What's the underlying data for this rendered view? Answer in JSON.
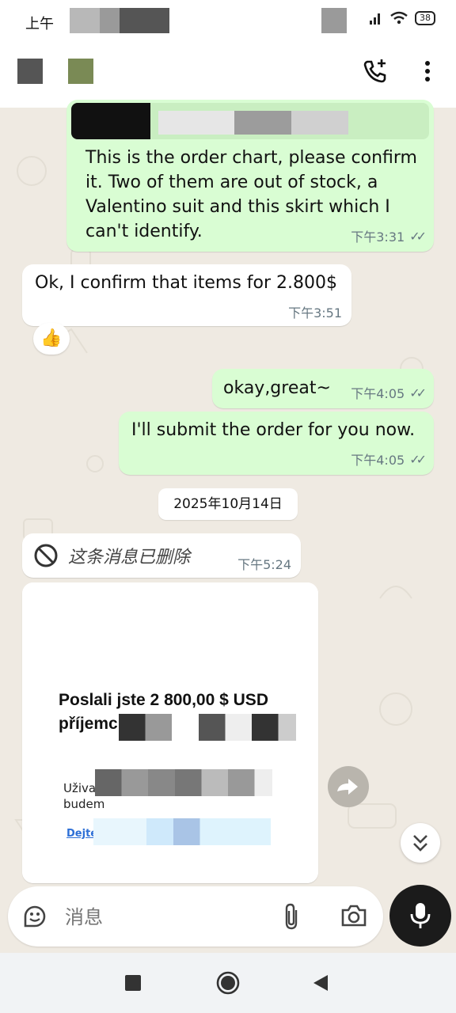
{
  "status_bar": {
    "time": "上午",
    "battery": "38"
  },
  "messages": [
    {
      "text": "This is the order chart, please confirm it. Two of them are out of stock, a Valentino suit and this skirt which I can't identify.",
      "time": "下午3:31"
    },
    {
      "text": "Ok, I confirm that items for 2.800$",
      "time": "下午3:51",
      "reaction": "👍"
    },
    {
      "text": "okay,great~",
      "time": "下午4:05"
    },
    {
      "text": "I'll submit the order for you now.",
      "time": "下午4:05"
    }
  ],
  "date_divider": "2025年10月14日",
  "deleted_message": {
    "text": "这条消息已删除",
    "time": "下午5:24"
  },
  "image_message": {
    "title_line1": "Poslali jste 2 800,00 $ USD",
    "title_line2": "příjemci",
    "body_line1": "Uživatel",
    "body_line2": "budem",
    "link": "Dejte"
  },
  "composer": {
    "placeholder": "消息"
  },
  "icons": {
    "app_bar": [
      "add-call-icon",
      "more-vert-icon"
    ],
    "composer": [
      "sticker-icon",
      "attach-icon",
      "camera-icon",
      "mic-icon"
    ],
    "nav": [
      "nav-recents-icon",
      "nav-home-icon",
      "nav-back-icon"
    ]
  },
  "colors": {
    "outgoing_bubble": "#d9fdd3",
    "incoming_bubble": "#ffffff",
    "chat_background": "#efeae2",
    "meta_text": "#667781"
  }
}
